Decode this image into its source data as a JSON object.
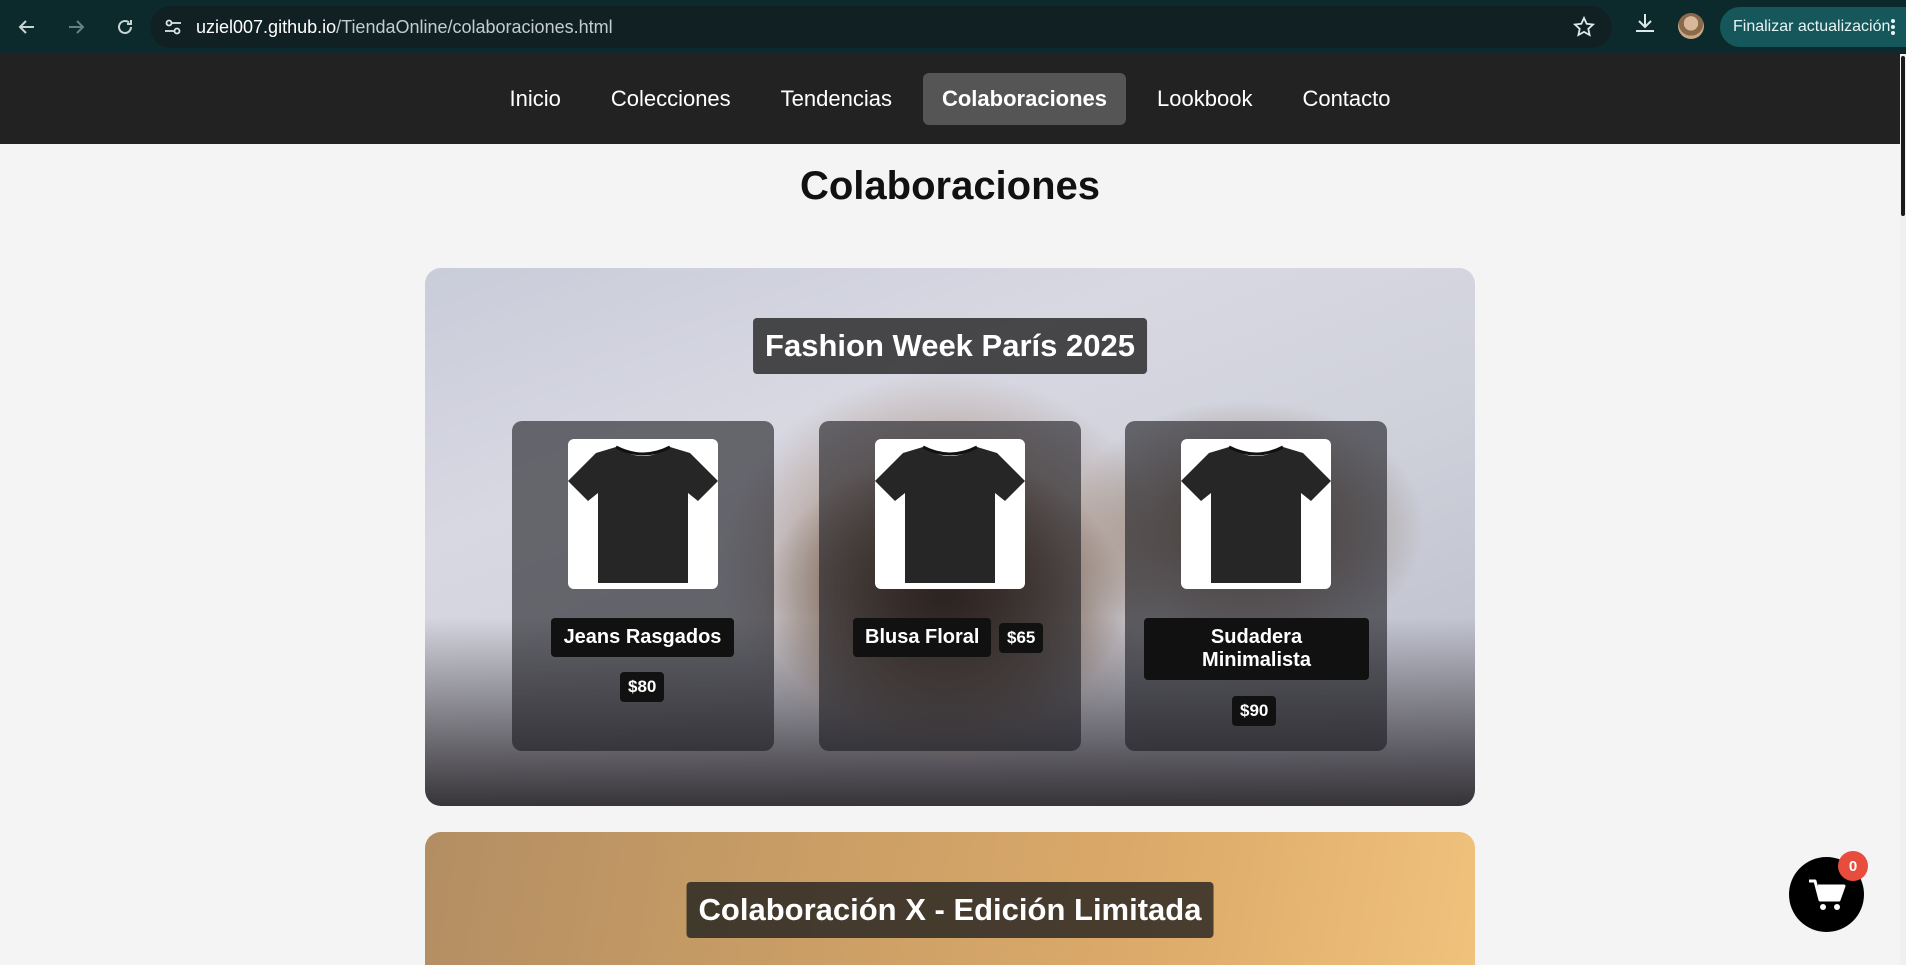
{
  "browser": {
    "url_host": "uziel007.github.io",
    "url_path": "/TiendaOnline/colaboraciones.html",
    "update_label": "Finalizar actualización"
  },
  "nav": {
    "items": [
      {
        "label": "Inicio"
      },
      {
        "label": "Colecciones"
      },
      {
        "label": "Tendencias"
      },
      {
        "label": "Colaboraciones",
        "active": true
      },
      {
        "label": "Lookbook"
      },
      {
        "label": "Contacto"
      }
    ]
  },
  "page": {
    "title": "Colaboraciones"
  },
  "collaborations": [
    {
      "title": "Fashion Week París 2025",
      "products": [
        {
          "name": "Jeans Rasgados",
          "price": "$80"
        },
        {
          "name": "Blusa Floral",
          "price": "$65"
        },
        {
          "name": "Sudadera Minimalista",
          "price": "$90"
        }
      ]
    },
    {
      "title": "Colaboración X - Edición Limitada"
    }
  ],
  "cart": {
    "count": "0"
  },
  "icons": [
    "back-icon",
    "forward-icon",
    "reload-icon",
    "site-info-icon",
    "star-icon",
    "download-icon",
    "kebab-icon",
    "tshirt-icon",
    "cart-icon"
  ]
}
